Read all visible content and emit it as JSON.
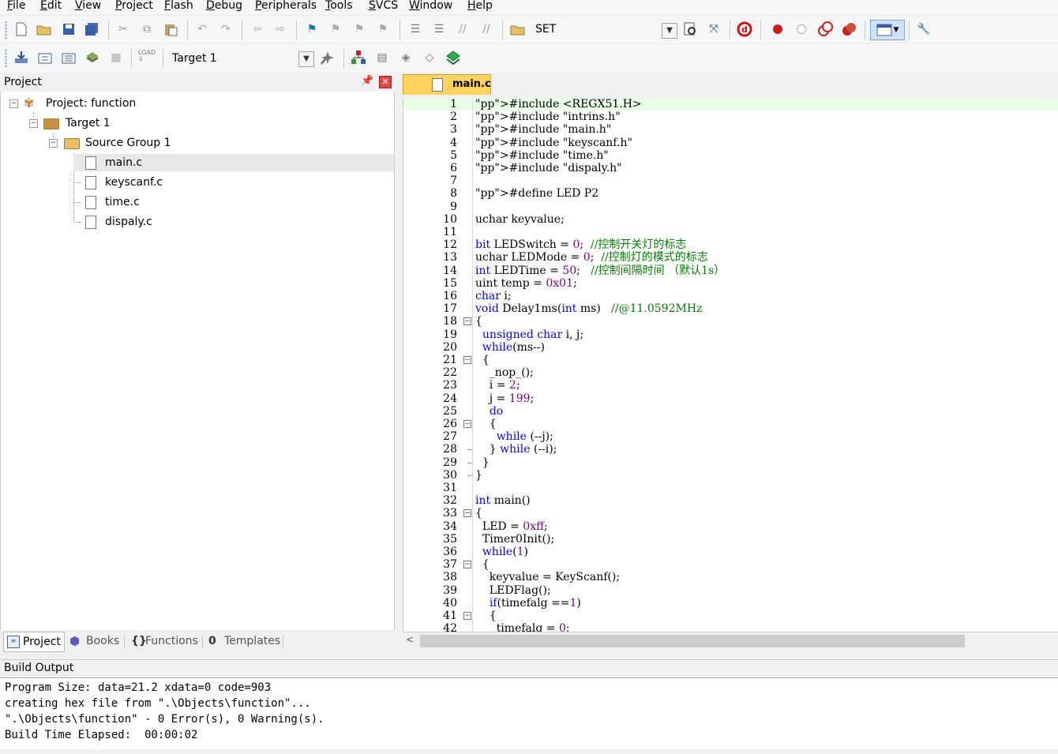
{
  "menu": [
    "File",
    "Edit",
    "View",
    "Project",
    "Flash",
    "Debug",
    "Peripherals",
    "Tools",
    "SVCS",
    "Window",
    "Help"
  ],
  "toolbar1": {
    "set_label": "SET"
  },
  "toolbar2": {
    "target_select": "Target 1"
  },
  "project_panel": {
    "title": "Project",
    "tree": {
      "project": "Project: function",
      "target": "Target 1",
      "group": "Source Group 1",
      "files": [
        "main.c",
        "keyscanf.c",
        "time.c",
        "dispaly.c"
      ]
    },
    "tabs": [
      "Project",
      "Books",
      "Functions",
      "Templates"
    ]
  },
  "editor": {
    "active_tab": "main.c",
    "lines": [
      {
        "n": "1",
        "t": "#include <REGX51.H>"
      },
      {
        "n": "2",
        "t": "#include \"intrins.h\""
      },
      {
        "n": "3",
        "t": "#include \"main.h\""
      },
      {
        "n": "4",
        "t": "#include \"keyscanf.h\""
      },
      {
        "n": "5",
        "t": "#include \"time.h\""
      },
      {
        "n": "6",
        "t": "#include \"dispaly.h\""
      },
      {
        "n": "7",
        "t": ""
      },
      {
        "n": "8",
        "t": "#define LED P2"
      },
      {
        "n": "9",
        "t": ""
      },
      {
        "n": "10",
        "t": "uchar keyvalue;"
      },
      {
        "n": "11",
        "t": ""
      },
      {
        "n": "12",
        "t": "bit LEDSwitch = 0;  //控制开关灯的标志"
      },
      {
        "n": "13",
        "t": "uchar LEDMode = 0;  //控制灯的模式的标志"
      },
      {
        "n": "14",
        "t": "int LEDTime = 50;   //控制间隔时间 （默认1s）"
      },
      {
        "n": "15",
        "t": "uint temp = 0x01;"
      },
      {
        "n": "16",
        "t": "char i;"
      },
      {
        "n": "17",
        "t": "void Delay1ms(int ms)   //@11.0592MHz"
      },
      {
        "n": "18",
        "t": "{"
      },
      {
        "n": "19",
        "t": "  unsigned char i, j;"
      },
      {
        "n": "20",
        "t": "  while(ms--)"
      },
      {
        "n": "21",
        "t": "  {"
      },
      {
        "n": "22",
        "t": "    _nop_();"
      },
      {
        "n": "23",
        "t": "    i = 2;"
      },
      {
        "n": "24",
        "t": "    j = 199;"
      },
      {
        "n": "25",
        "t": "    do"
      },
      {
        "n": "26",
        "t": "    {"
      },
      {
        "n": "27",
        "t": "      while (--j);"
      },
      {
        "n": "28",
        "t": "    } while (--i);"
      },
      {
        "n": "29",
        "t": "  }"
      },
      {
        "n": "30",
        "t": "}"
      },
      {
        "n": "31",
        "t": ""
      },
      {
        "n": "32",
        "t": "int main()"
      },
      {
        "n": "33",
        "t": "{"
      },
      {
        "n": "34",
        "t": "  LED = 0xff;"
      },
      {
        "n": "35",
        "t": "  Timer0Init();"
      },
      {
        "n": "36",
        "t": "  while(1)"
      },
      {
        "n": "37",
        "t": "  {"
      },
      {
        "n": "38",
        "t": "    keyvalue = KeyScanf();"
      },
      {
        "n": "39",
        "t": "    LEDFlag();"
      },
      {
        "n": "40",
        "t": "    if(timefalg ==1)"
      },
      {
        "n": "41",
        "t": "    {"
      },
      {
        "n": "42",
        "t": "      timefalg = 0;"
      }
    ]
  },
  "build_output": {
    "title": "Build Output",
    "lines": [
      "Program Size: data=21.2 xdata=0 code=903",
      "creating hex file from \".\\Objects\\function\"...",
      "\".\\Objects\\function\" - 0 Error(s), 0 Warning(s).",
      "Build Time Elapsed:  00:00:02"
    ]
  }
}
